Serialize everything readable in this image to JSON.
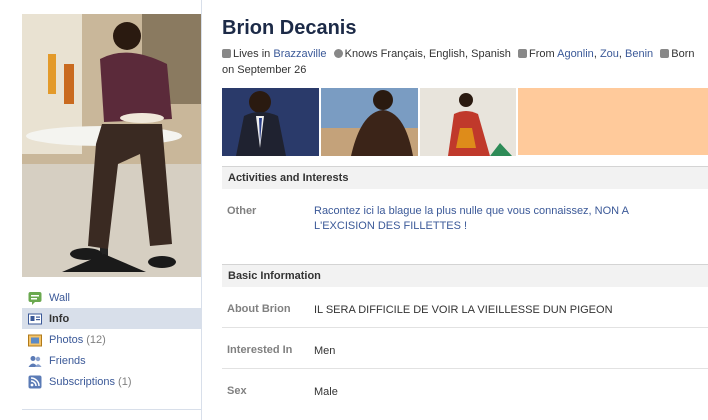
{
  "profile": {
    "name": "Brion Decanis",
    "lives_prefix": "Lives in",
    "lives_city": "Brazzaville",
    "knows": "Knows Français, English, Spanish",
    "from_prefix": "From",
    "from_1": "Agonlin",
    "from_2": "Zou",
    "from_3": "Benin",
    "born": "Born on September 26"
  },
  "nav": {
    "items": [
      {
        "label": "Wall",
        "count": "",
        "icon": "wall-icon"
      },
      {
        "label": "Info",
        "count": "",
        "icon": "info-icon",
        "active": true
      },
      {
        "label": "Photos",
        "count": "(12)",
        "icon": "photos-icon"
      },
      {
        "label": "Friends",
        "count": "",
        "icon": "friends-icon"
      },
      {
        "label": "Subscriptions",
        "count": "(1)",
        "icon": "subscriptions-icon"
      }
    ]
  },
  "sections": {
    "activities": {
      "title": "Activities and Interests",
      "other_label": "Other",
      "other_value": "Racontez ici la blague la plus nulle que vous connaissez, NON A L'EXCISION DES FILLETTES !"
    },
    "basic": {
      "title": "Basic Information",
      "about_label": "About Brion",
      "about_value": "IL SERA DIFFICILE DE VOIR LA VIEILLESSE DUN PIGEON",
      "interested_label": "Interested In",
      "interested_value": "Men",
      "sex_label": "Sex",
      "sex_value": "Male"
    }
  },
  "colors": {
    "link": "#3b5998",
    "nav_active_bg": "#d8dfea",
    "placeholder_photo": "#ffca9b"
  }
}
